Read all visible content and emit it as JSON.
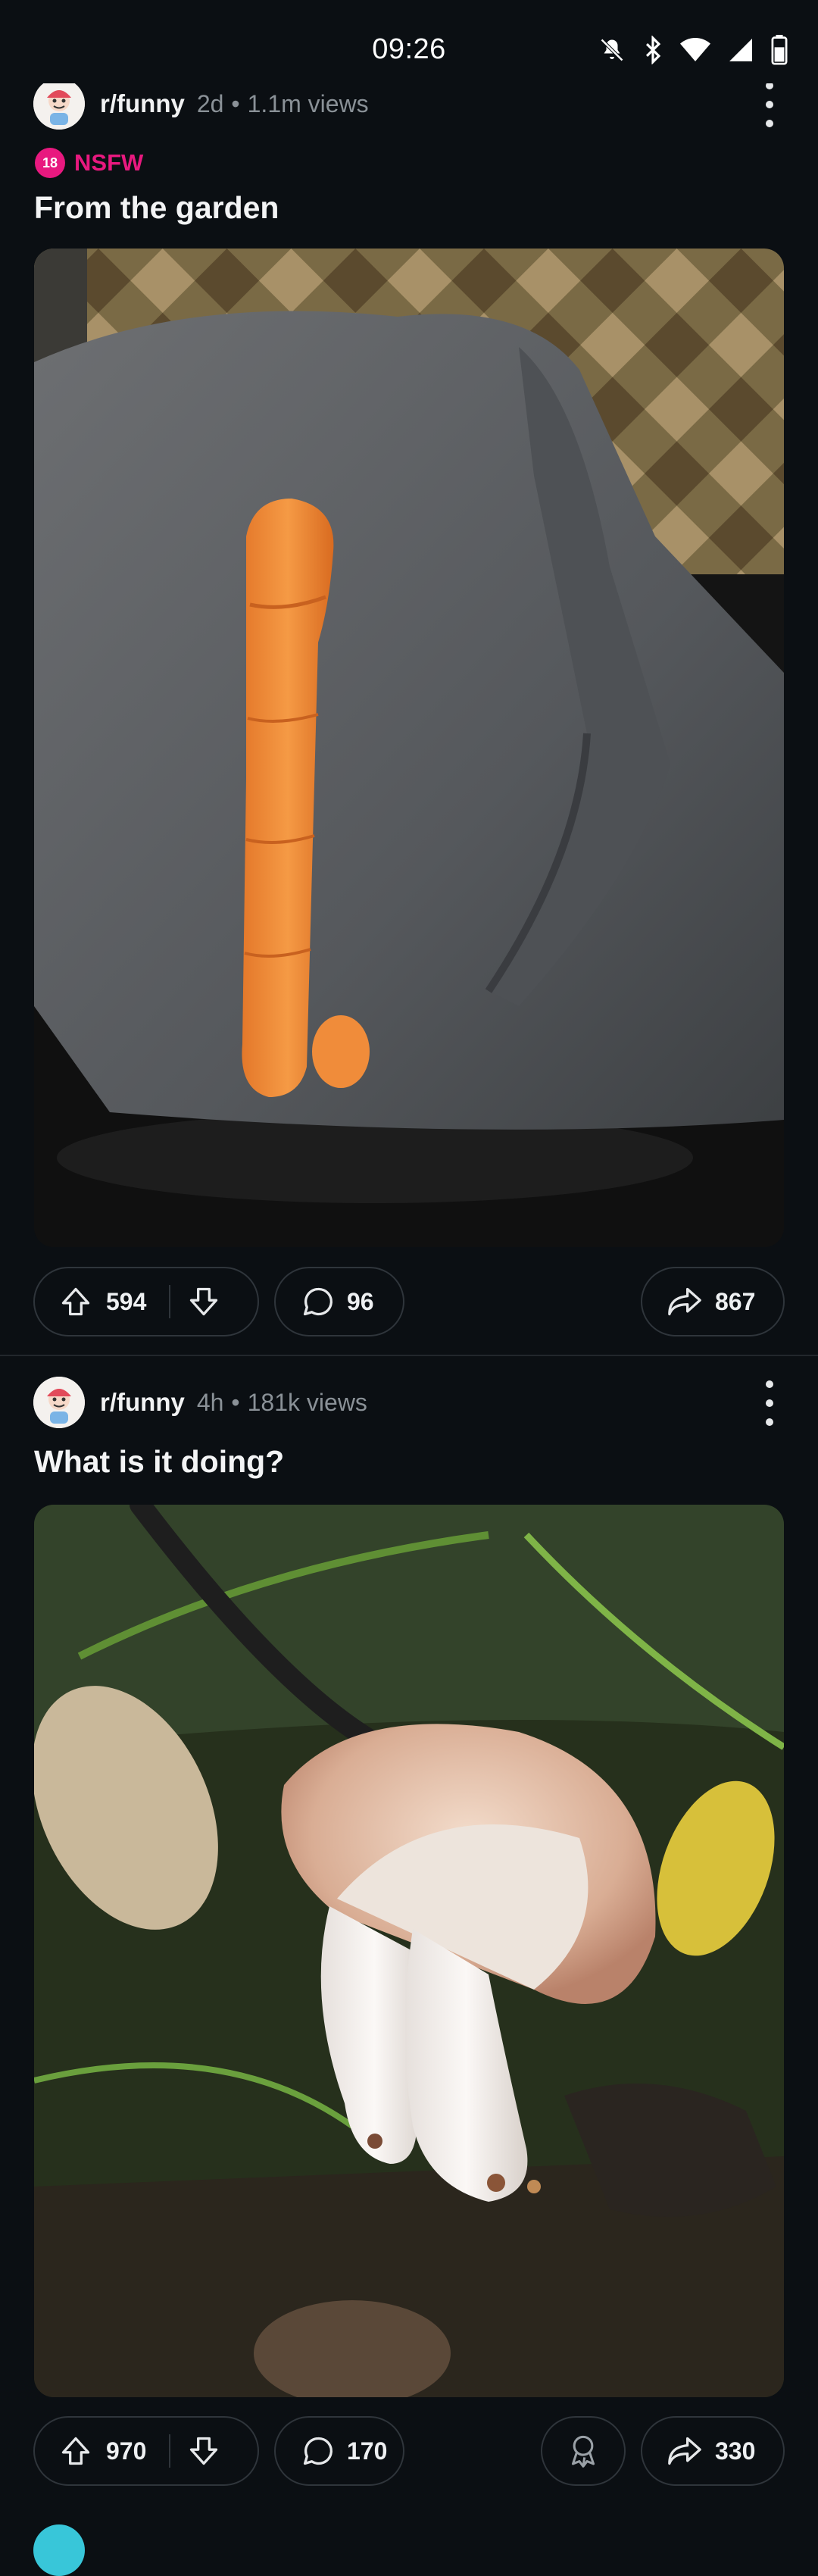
{
  "status_bar": {
    "time": "09:26",
    "icons": [
      "bell-off-icon",
      "bluetooth-icon",
      "wifi-icon",
      "signal-icon",
      "battery-icon"
    ]
  },
  "posts": [
    {
      "subreddit": "r/funny",
      "age": "2d",
      "views": "1.1m views",
      "nsfw_badge": "18",
      "nsfw_label": "NSFW",
      "title": "From the garden",
      "image_description_icon": "carrot-photo",
      "upvotes": "594",
      "comments": "96",
      "shares": "867"
    },
    {
      "subreddit": "r/funny",
      "age": "4h",
      "views": "181k views",
      "title": "What is it doing?",
      "image_description_icon": "mushroom-photo",
      "upvotes": "970",
      "comments": "170",
      "shares": "330"
    }
  ],
  "colors": {
    "background": "#0b0f13",
    "nsfw": "#e8197f",
    "meta_text": "#8a9197",
    "pill_border": "#2f353b"
  }
}
